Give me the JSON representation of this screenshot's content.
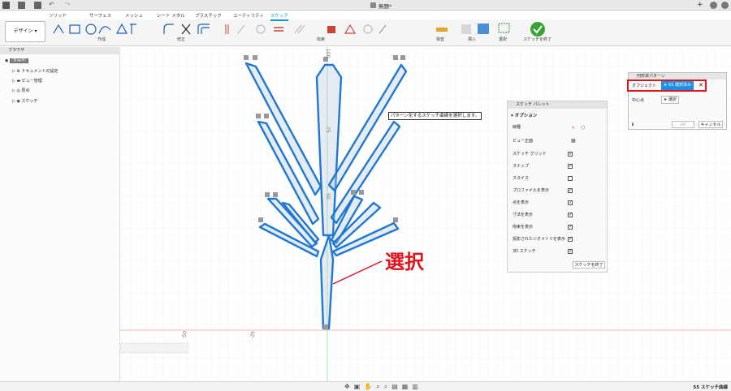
{
  "window": {
    "title": "無題*"
  },
  "tabs": [
    "ソリッド",
    "サーフェス",
    "メッシュ",
    "シート メタル",
    "プラスチック",
    "ユーティリティ",
    "スケッチ"
  ],
  "toolbar": {
    "design_label": "デザイン",
    "groups": [
      "作成",
      "修正",
      "拘束",
      "検査",
      "挿入",
      "選択",
      "スケッチを終了"
    ]
  },
  "browser": {
    "header": "ブラウザ",
    "items": [
      "(未保存)",
      "ドキュメントの設定",
      "ビュー管理",
      "原点",
      "スケッチ"
    ]
  },
  "canvas": {
    "tooltip": "パターン化するスケッチ曲線を選択します。",
    "annotation": "選択",
    "axis_labels": [
      "-50",
      "-25",
      "50",
      "75",
      "100"
    ]
  },
  "palette": {
    "title": "スケッチ パレット",
    "section": "オプション",
    "rows": [
      {
        "label": "線種",
        "type": "icons"
      },
      {
        "label": "ビュー正面",
        "type": "icon"
      },
      {
        "label": "スケッチ グリッド",
        "checked": true
      },
      {
        "label": "スナップ",
        "checked": true
      },
      {
        "label": "スライス",
        "checked": false
      },
      {
        "label": "プロファイルを表示",
        "checked": true
      },
      {
        "label": "点を表示",
        "checked": true
      },
      {
        "label": "寸法を表示",
        "checked": true
      },
      {
        "label": "拘束を表示",
        "checked": true
      },
      {
        "label": "投影されたジオメトリを表示",
        "checked": true
      },
      {
        "label": "3D スケッチ",
        "checked": true
      }
    ],
    "finish_button": "スケッチを終了"
  },
  "dialog": {
    "title": "円形状パターン",
    "object_label": "オブジェクト",
    "object_value": "55 選択済み",
    "center_label": "中心点",
    "center_value": "選択",
    "ok": "OK",
    "cancel": "キャンセル"
  },
  "status": {
    "right": "55 スケッチ曲線"
  }
}
